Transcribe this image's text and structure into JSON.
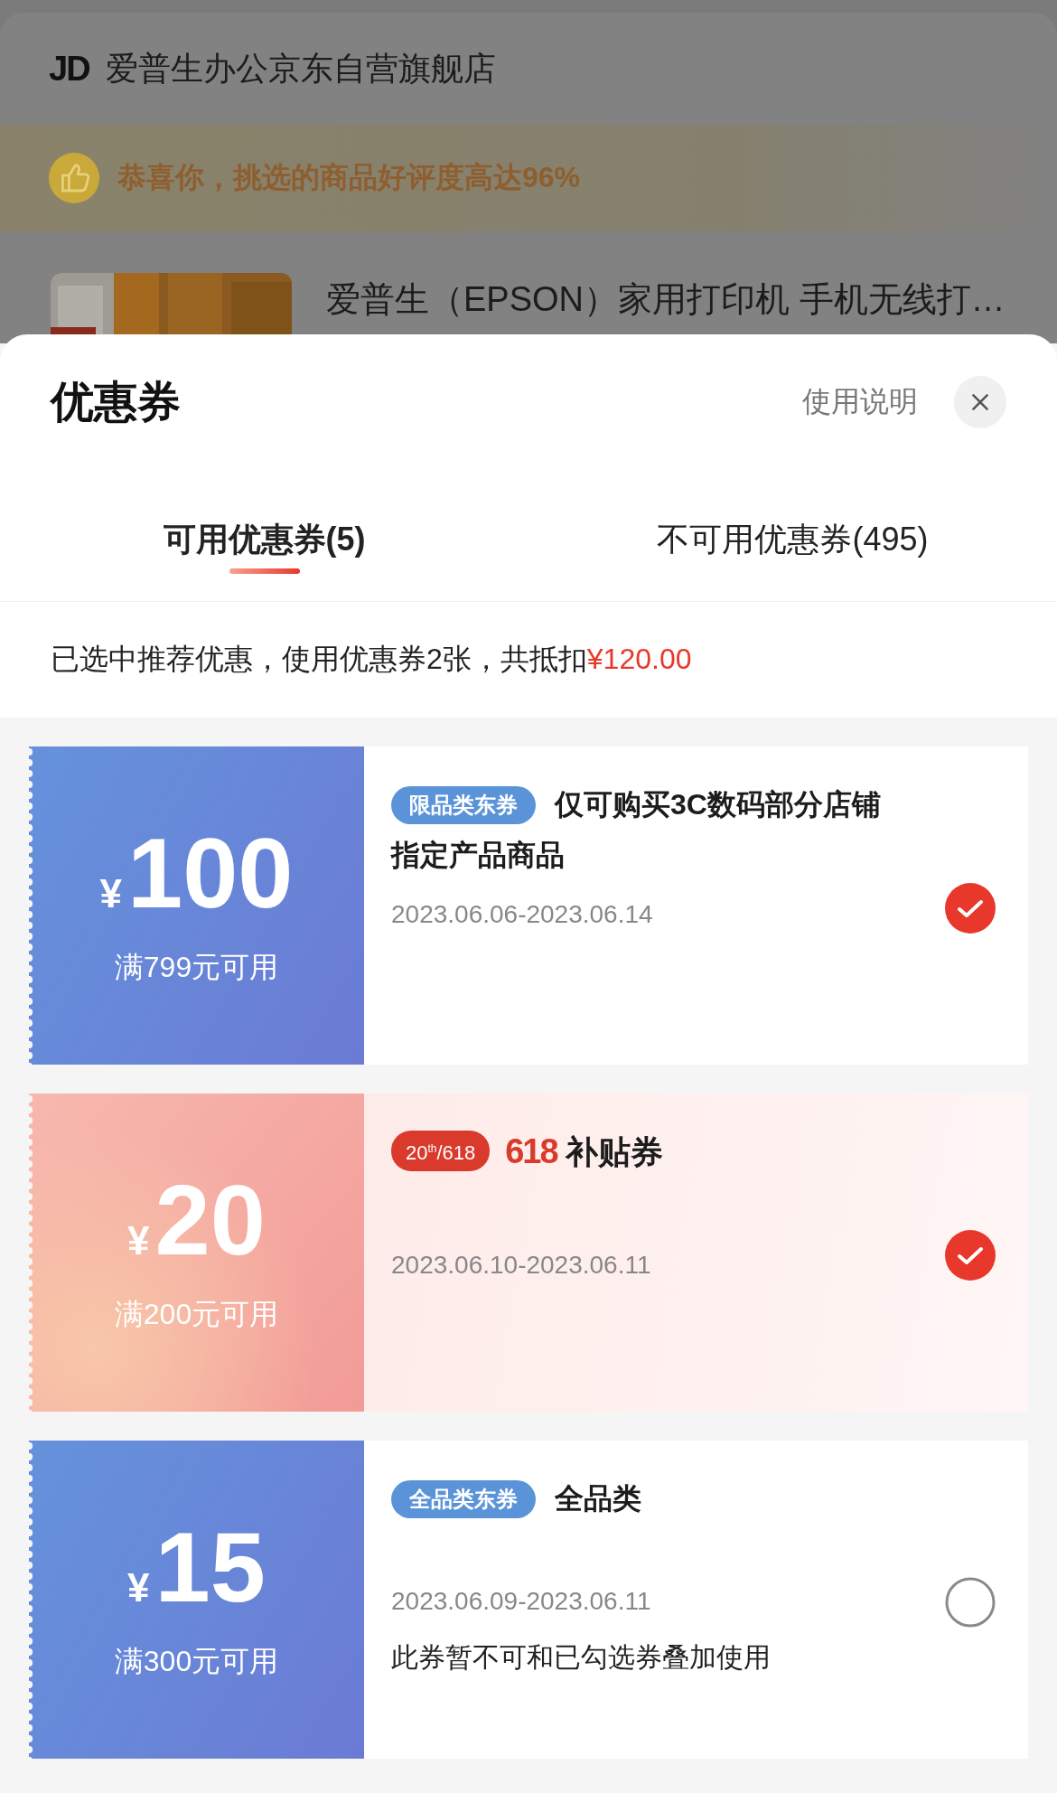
{
  "store": {
    "logo": "JD",
    "name": "爱普生办公京东自营旗舰店"
  },
  "banner": {
    "text": "恭喜你，挑选的商品好评度高达96%"
  },
  "product": {
    "title": "爱普生（EPSON）家用打印机 手机无线打…"
  },
  "sheet": {
    "title": "优惠券",
    "help": "使用说明"
  },
  "tabs": [
    {
      "label": "可用优惠券(5)",
      "selected": true
    },
    {
      "label": "不可用优惠券(495)",
      "selected": false
    }
  ],
  "summary": {
    "text": "已选中推荐优惠，使用优惠券2张，共抵扣",
    "amount": "¥120.00"
  },
  "coupons": [
    {
      "kind": "blue",
      "currency": "¥",
      "amount": "100",
      "condition": "满799元可用",
      "badge": {
        "kind": "tag",
        "text": "限品类东券"
      },
      "title_lines": [
        "仅可购买3C数码部分店铺",
        "指定产品商品"
      ],
      "date": "2023.06.06-2023.06.14",
      "selected": true
    },
    {
      "kind": "pink",
      "currency": "¥",
      "amount": "20",
      "condition": "满200元可用",
      "badge": {
        "kind": "event",
        "text": "20$^{th}$/618"
      },
      "title_prefix": "618",
      "title_lines": [
        "补贴券"
      ],
      "date": "2023.06.10-2023.06.11",
      "selected": true
    },
    {
      "kind": "blue",
      "currency": "¥",
      "amount": "15",
      "condition": "满300元可用",
      "badge": {
        "kind": "tag",
        "text": "全品类东券"
      },
      "title_lines": [
        "全品类"
      ],
      "date": "2023.06.09-2023.06.11",
      "note": "此券暂不可和已勾选券叠加使用",
      "selected": false
    }
  ]
}
